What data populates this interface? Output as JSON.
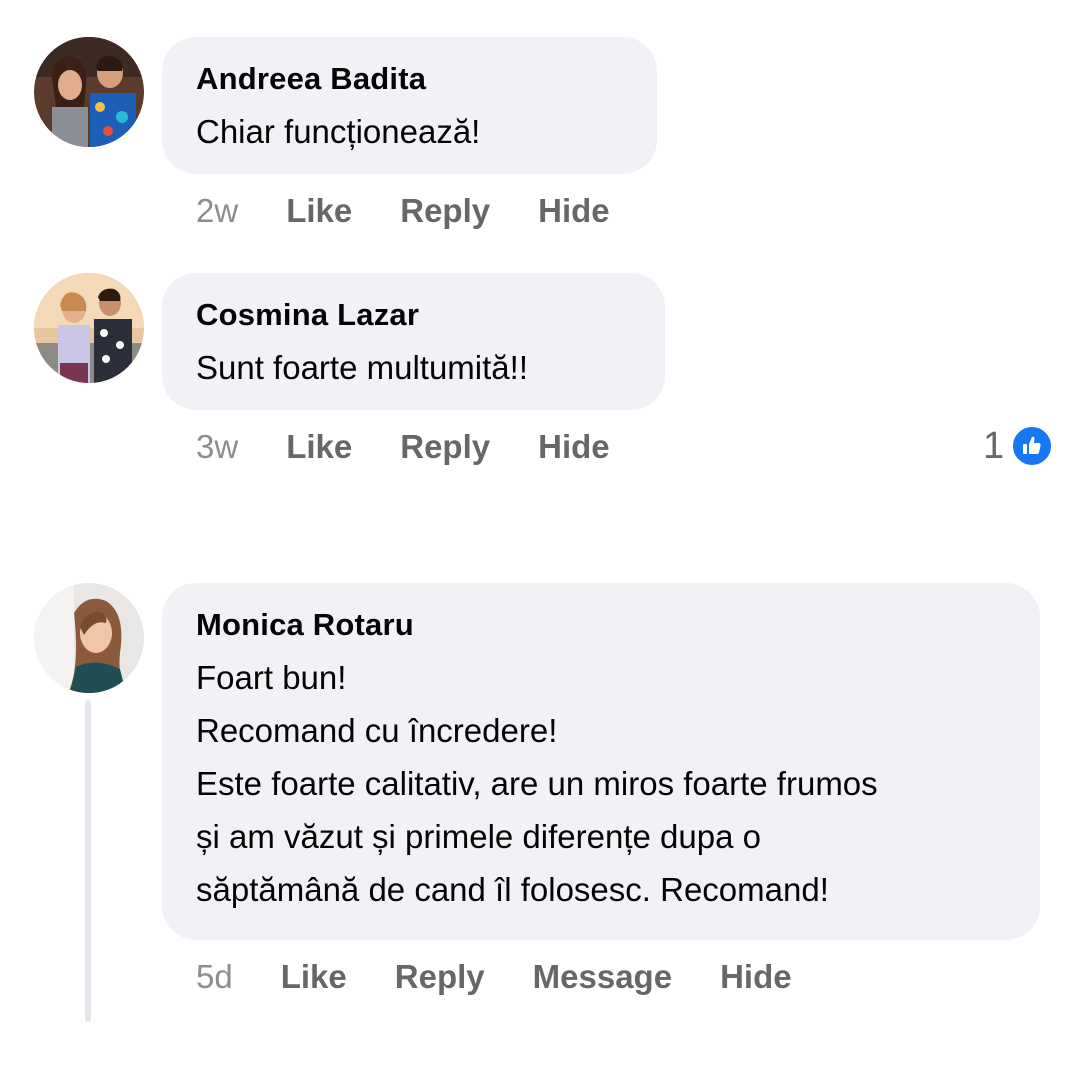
{
  "comments": [
    {
      "author": "Andreea Badita",
      "text": "Chiar funcționează!",
      "time": "2w",
      "actions": [
        "Like",
        "Reply",
        "Hide"
      ],
      "reactions": null
    },
    {
      "author": "Cosmina Lazar",
      "text": "Sunt foarte multumită!!",
      "time": "3w",
      "actions": [
        "Like",
        "Reply",
        "Hide"
      ],
      "reactions": {
        "count": "1",
        "type": "like"
      }
    },
    {
      "author": "Monica Rotaru",
      "lines": [
        "Foart bun!",
        "Recomand cu încredere!",
        "Este foarte calitativ, are un miros foarte frumos",
        "și am văzut și primele diferențe dupa o",
        "săptămână de cand îl folosesc. Recomand!"
      ],
      "time": "5d",
      "actions": [
        "Like",
        "Reply",
        "Message",
        "Hide"
      ]
    }
  ],
  "colors": {
    "bubble": "#f0f2f5",
    "action_text": "#65676b",
    "like_blue": "#1877f2"
  }
}
